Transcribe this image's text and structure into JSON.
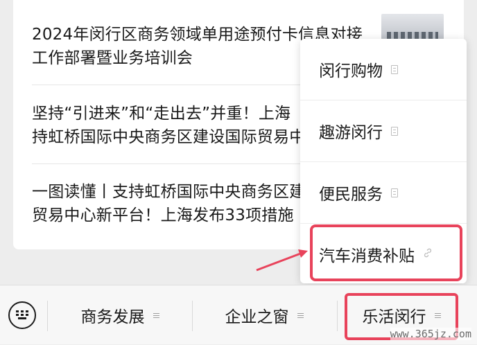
{
  "articles": [
    {
      "line1": "2024年闵行区商务领域单用途预付卡信息对接",
      "line2": "工作部署暨业务培训会"
    },
    {
      "line1": "坚持“引进来”和“走出去”并重！上海",
      "line2": "持虹桥国际中央商务区建设国际贸易中"
    },
    {
      "line1": "一图读懂丨支持虹桥国际中央商务区建",
      "line2": "贸易中心新平台！上海发布33项措施"
    }
  ],
  "popup_menu": {
    "items": [
      {
        "label": "闵行购物",
        "icon": "doc-icon"
      },
      {
        "label": "趣游闵行",
        "icon": "doc-icon"
      },
      {
        "label": "便民服务",
        "icon": "doc-icon"
      },
      {
        "label": "汽车消费补贴",
        "icon": "link-icon"
      }
    ]
  },
  "bottom_bar": {
    "keyboard_icon": "keyboard-icon",
    "tabs": [
      {
        "label": "商务发展",
        "icon": "menu-icon"
      },
      {
        "label": "企业之窗",
        "icon": "menu-icon"
      },
      {
        "label": "乐活闵行",
        "icon": "menu-icon"
      }
    ]
  },
  "watermark": "www.365jz.com",
  "colors": {
    "highlight": "#e8435b",
    "background": "#ededed"
  }
}
